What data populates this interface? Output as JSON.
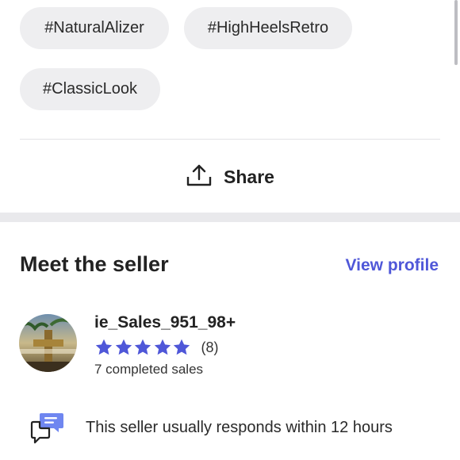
{
  "tags": [
    "#NaturalAlizer",
    "#HighHeelsRetro",
    "#ClassicLook"
  ],
  "share": {
    "label": "Share",
    "icon": "share-upload-icon"
  },
  "seller": {
    "section_title": "Meet the seller",
    "view_profile": "View profile",
    "username": "ie_Sales_951_98+",
    "rating_stars": 5,
    "rating_count": "(8)",
    "completed_sales": "7 completed sales",
    "response_note": "This seller usually responds within 12 hours"
  },
  "colors": {
    "accent": "#4f57d8",
    "tag_bg": "#eeeef0",
    "section_divider": "#e9e9ec"
  }
}
